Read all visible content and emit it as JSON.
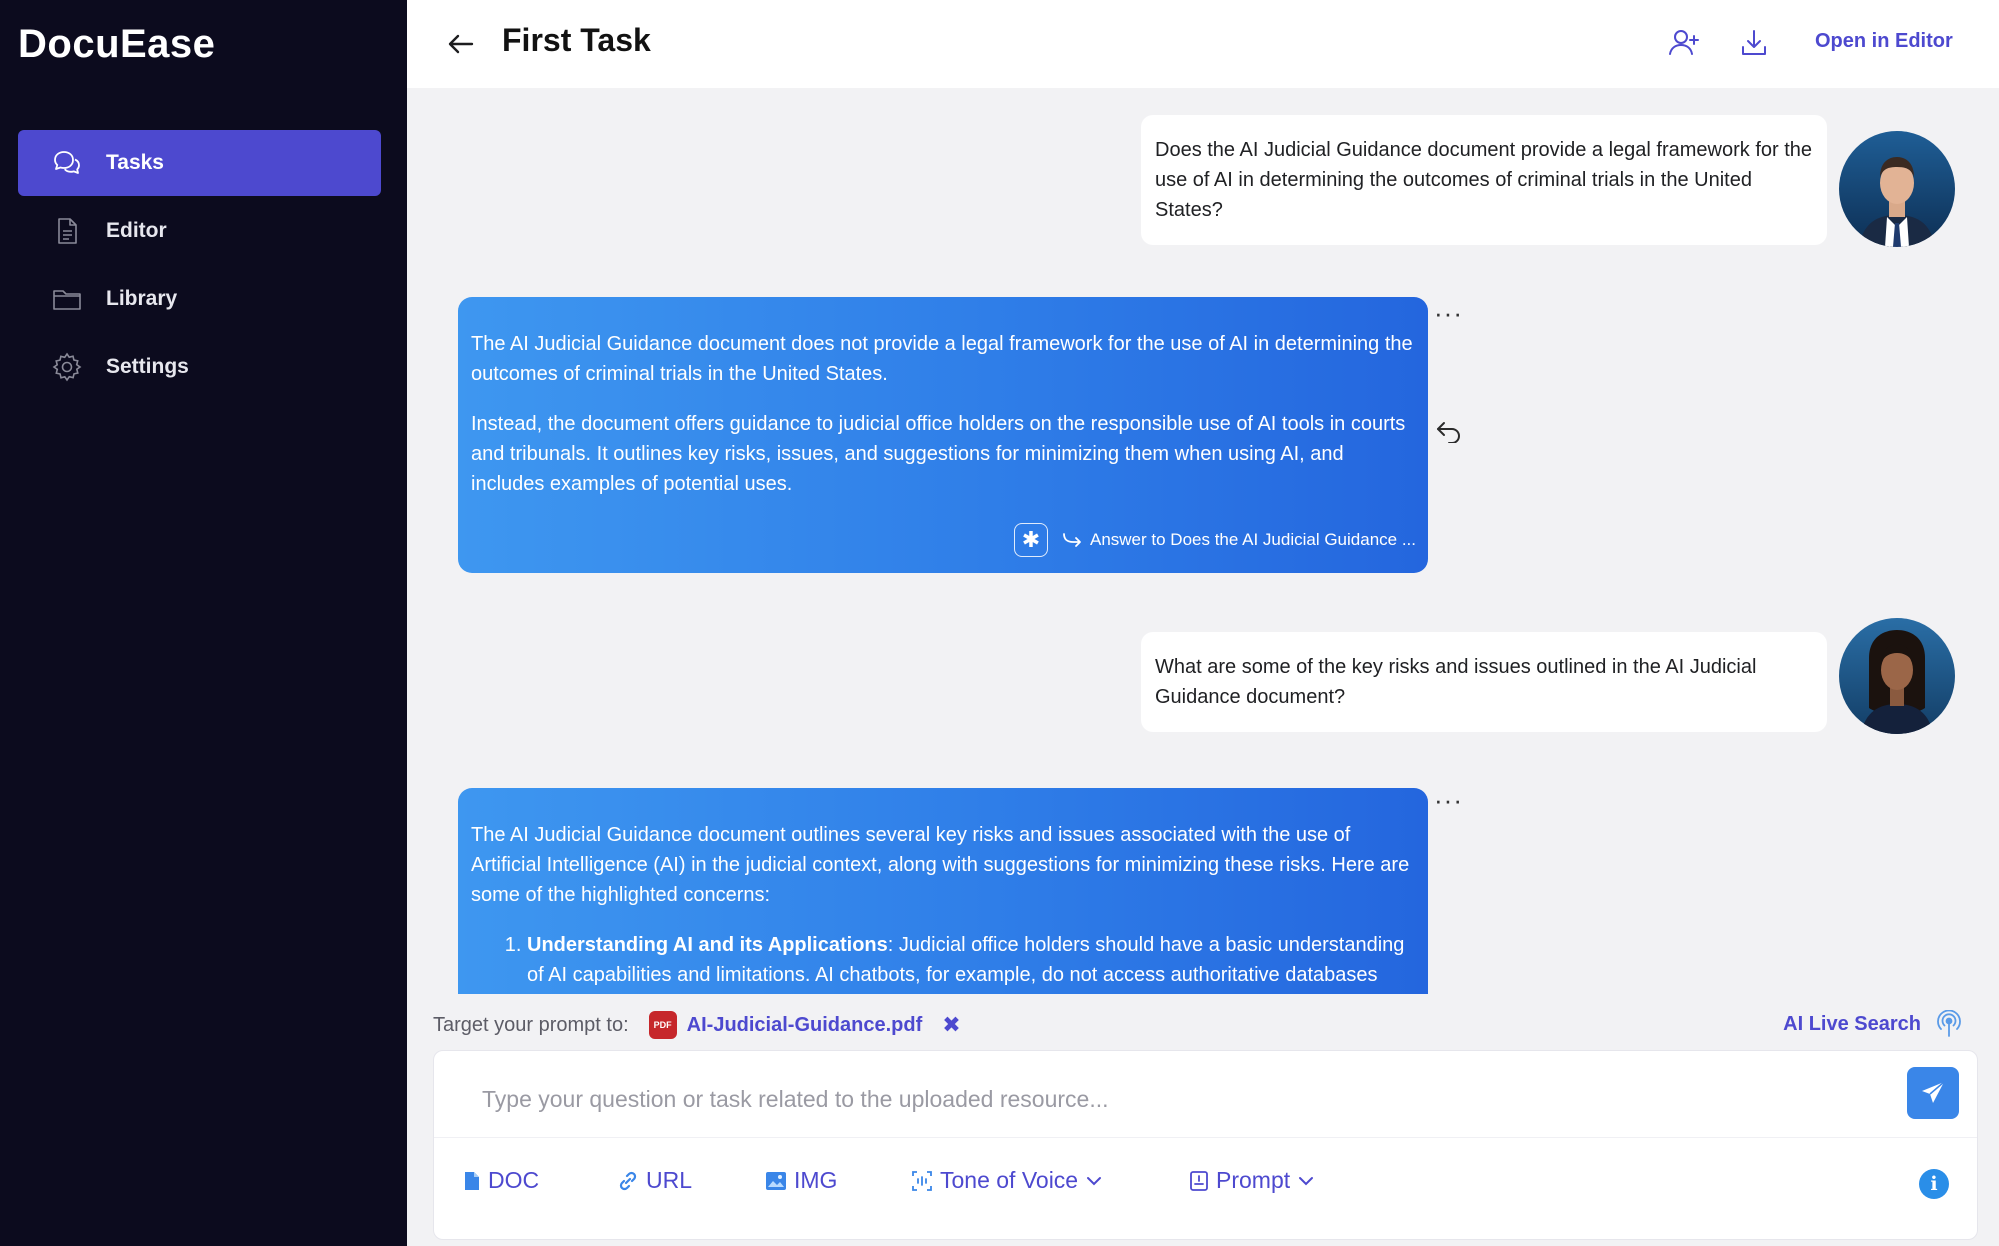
{
  "app": {
    "brand": "DocuEase"
  },
  "sidebar": {
    "items": [
      {
        "label": "Tasks",
        "icon": "chat-bubbles-icon",
        "active": true
      },
      {
        "label": "Editor",
        "icon": "document-icon",
        "active": false
      },
      {
        "label": "Library",
        "icon": "folder-icon",
        "active": false
      },
      {
        "label": "Settings",
        "icon": "gear-icon",
        "active": false
      }
    ]
  },
  "header": {
    "title": "First Task",
    "open_editor_label": "Open in Editor",
    "icons": [
      "back-arrow-icon",
      "add-user-icon",
      "download-icon"
    ]
  },
  "messages": [
    {
      "role": "user",
      "text": "Does the AI Judicial Guidance document provide a legal framework for the use of AI in determining the outcomes of criminal trials in the United States?"
    },
    {
      "role": "ai",
      "paragraphs": [
        "The AI Judicial Guidance document does not provide a legal framework for the use of AI in determining the outcomes of criminal trials in the United States.",
        "Instead, the document offers guidance to judicial office holders on the responsible use of AI tools in courts and tribunals. It outlines key risks, issues, and suggestions for minimizing them when using AI, and includes examples of potential uses."
      ],
      "answer_ref": "Answer to Does the AI Judicial Guidance ..."
    },
    {
      "role": "user",
      "text": "What are some of the key risks and issues outlined in the AI Judicial Guidance document?"
    },
    {
      "role": "ai",
      "paragraphs": [
        "The AI Judicial Guidance document outlines several key risks and issues associated with the use of Artificial Intelligence (AI) in the judicial context, along with suggestions for minimizing these risks. Here are some of the highlighted concerns:"
      ],
      "list": [
        {
          "title": "Understanding AI and its Applications",
          "text": ": Judicial office holders should have a basic understanding of AI capabilities and limitations. AI chatbots, for example, do not access authoritative databases and may generate text that sounds plausible but is inaccurate."
        }
      ]
    }
  ],
  "composer": {
    "target_label": "Target your prompt to:",
    "target_file": "AI-Judicial-Guidance.pdf",
    "live_search_label": "AI Live Search",
    "placeholder": "Type your question or task related to the uploaded resource...",
    "tools": [
      {
        "label": "DOC",
        "icon": "doc-icon"
      },
      {
        "label": "URL",
        "icon": "link-icon"
      },
      {
        "label": "IMG",
        "icon": "image-icon"
      },
      {
        "label": "Tone of Voice",
        "icon": "tone-icon"
      },
      {
        "label": "Prompt",
        "icon": "prompt-icon"
      }
    ]
  },
  "colors": {
    "sidebar_bg": "#0c0b1e",
    "accent": "#4d49cf",
    "ai_bubble": "#2f7ee8",
    "pdf_red": "#c6272b"
  }
}
